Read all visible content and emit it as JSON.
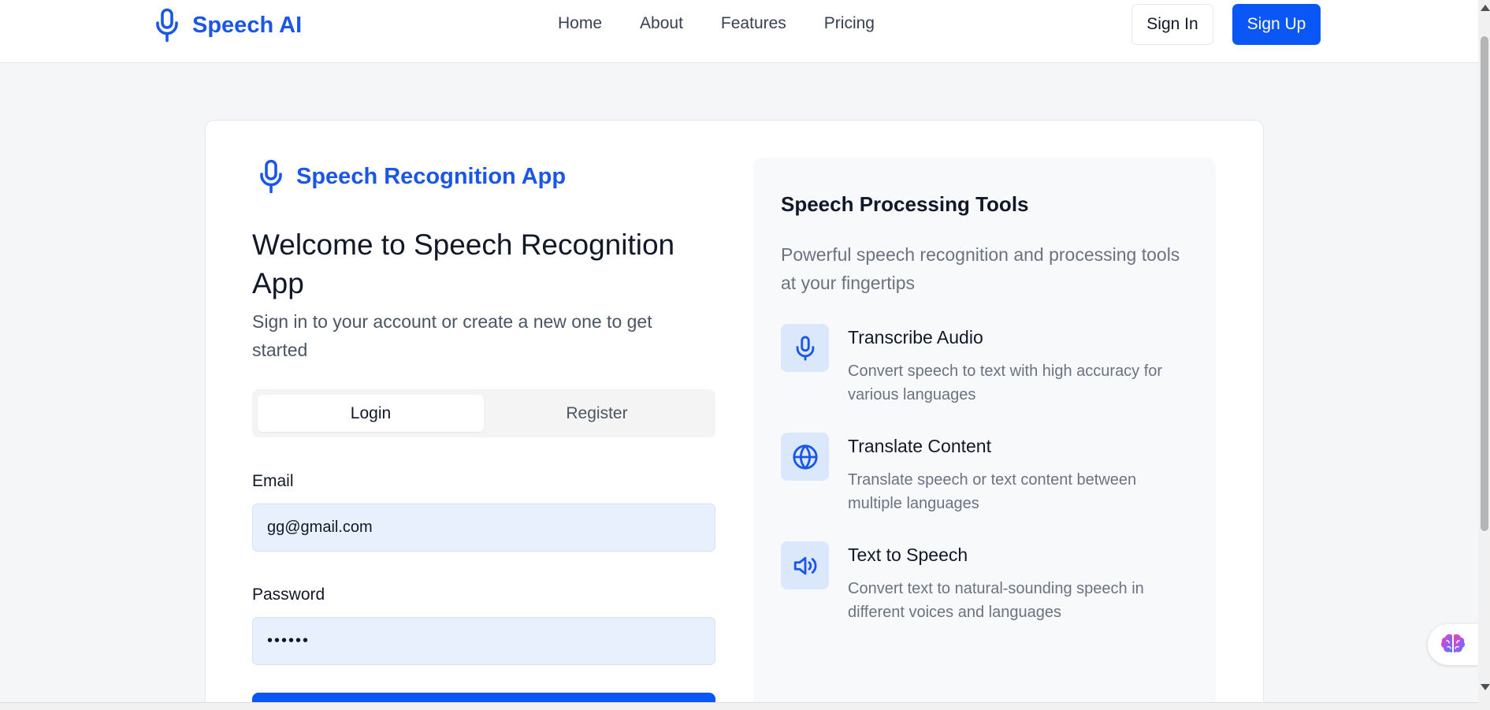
{
  "header": {
    "brand": "Speech AI",
    "nav": [
      "Home",
      "About",
      "Features",
      "Pricing"
    ],
    "signin": "Sign In",
    "signup": "Sign Up"
  },
  "login": {
    "app_title": "Speech Recognition App",
    "welcome": "Welcome to Speech Recognition App",
    "subtitle": "Sign in to your account or create a new one to get started",
    "tabs": [
      "Login",
      "Register"
    ],
    "active_tab": "Login",
    "email_label": "Email",
    "email_value": "gg@gmail.com",
    "password_label": "Password",
    "password_value": "••••••"
  },
  "panel": {
    "title": "Speech Processing Tools",
    "desc": "Powerful speech recognition and processing tools at your fingertips",
    "features": [
      {
        "icon": "microphone-icon",
        "title": "Transcribe Audio",
        "desc": "Convert speech to text with high accuracy for various languages"
      },
      {
        "icon": "globe-icon",
        "title": "Translate Content",
        "desc": "Translate speech or text content between multiple languages"
      },
      {
        "icon": "speaker-icon",
        "title": "Text to Speech",
        "desc": "Convert text to natural-sounding speech in different voices and languages"
      }
    ]
  },
  "colors": {
    "accent": "#0b57f5",
    "brand": "#1a56e8",
    "icon_bg": "#dbe8fc"
  }
}
